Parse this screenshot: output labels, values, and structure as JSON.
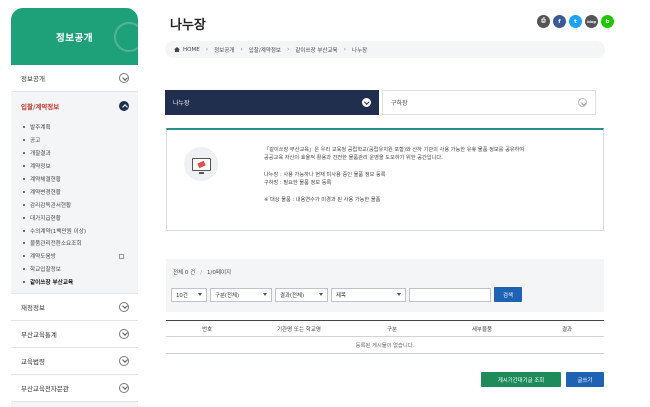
{
  "sidebar": {
    "title": "정보공개",
    "sections": [
      {
        "label": "정보공개"
      },
      {
        "label": "입찰/계약정보"
      },
      {
        "label": "재정정보"
      },
      {
        "label": "부산교육통계"
      },
      {
        "label": "교육법령"
      },
      {
        "label": "부산교육전자문관"
      }
    ],
    "sub_items": [
      {
        "label": "발주계획"
      },
      {
        "label": "공고"
      },
      {
        "label": "개찰결과"
      },
      {
        "label": "계약정보"
      },
      {
        "label": "계약체결현황"
      },
      {
        "label": "계약변경현황"
      },
      {
        "label": "감리감독관서현황"
      },
      {
        "label": "대가지급현황"
      },
      {
        "label": "수의계약(1백만원 이상)"
      },
      {
        "label": "물품관리전환소요조회"
      },
      {
        "label": "계약도움방"
      },
      {
        "label": "학교입찰정보"
      },
      {
        "label": "같이쓰장 부산교육"
      }
    ]
  },
  "header": {
    "title": "나누장",
    "share_buttons": [
      {
        "icon": "print-icon",
        "glyph": "⎙",
        "color": "#555555"
      },
      {
        "icon": "facebook-icon",
        "glyph": "f",
        "color": "#3b5998"
      },
      {
        "icon": "twitter-icon",
        "glyph": "t",
        "color": "#1da1f2"
      },
      {
        "icon": "blog-icon",
        "glyph": "blog",
        "color": "#555555"
      },
      {
        "icon": "naver-band-icon",
        "glyph": "b",
        "color": "#1ec800"
      }
    ]
  },
  "breadcrumb": [
    "HOME",
    "정보공개",
    "입찰/계약정보",
    "같이쓰장 부산교육",
    "나누장"
  ],
  "tabs": [
    {
      "label": "나누장"
    },
    {
      "label": "구하장"
    }
  ],
  "info": {
    "desc_line1": "「같이쓰장 부산교육」은 우리 교육청 공립학교(공립유치원 포함)와 산하 기관의 사용 가능한 유휴 물품 정보를 공유하여",
    "desc_line2": "공공교육 자산의 효율적 활용과 건전한 물품관리 운영을 도모하기 위한 공간입니다.",
    "line3": "나누장 : 사용 가능하나 현재 미사용 중인 물품 정보 등록",
    "line4": "구하장 : 필요한 물품 정보 등록",
    "note": "※ 대상 물품 : 내용연수가 미경과 된 사용 가능한 물품"
  },
  "search": {
    "total": "전체 0 건",
    "pages": "1/0페이지",
    "selects": [
      {
        "name": "page-size-select",
        "value": "10건",
        "width": 36
      },
      {
        "name": "category-select",
        "value": "구분(전체)",
        "width": 62
      },
      {
        "name": "result-select",
        "value": "결과(전체)",
        "width": 53
      },
      {
        "name": "field-select",
        "value": "제목",
        "width": 75
      }
    ],
    "input_value": "",
    "button": "검색"
  },
  "table": {
    "columns": [
      "번호",
      "기관명 또는 학교명",
      "구분",
      "세부물품",
      "결과"
    ],
    "empty": "등록된 게시물이 없습니다."
  },
  "buttons": {
    "term_search": "게시기간대기글 조회",
    "write": "글쓰기"
  }
}
